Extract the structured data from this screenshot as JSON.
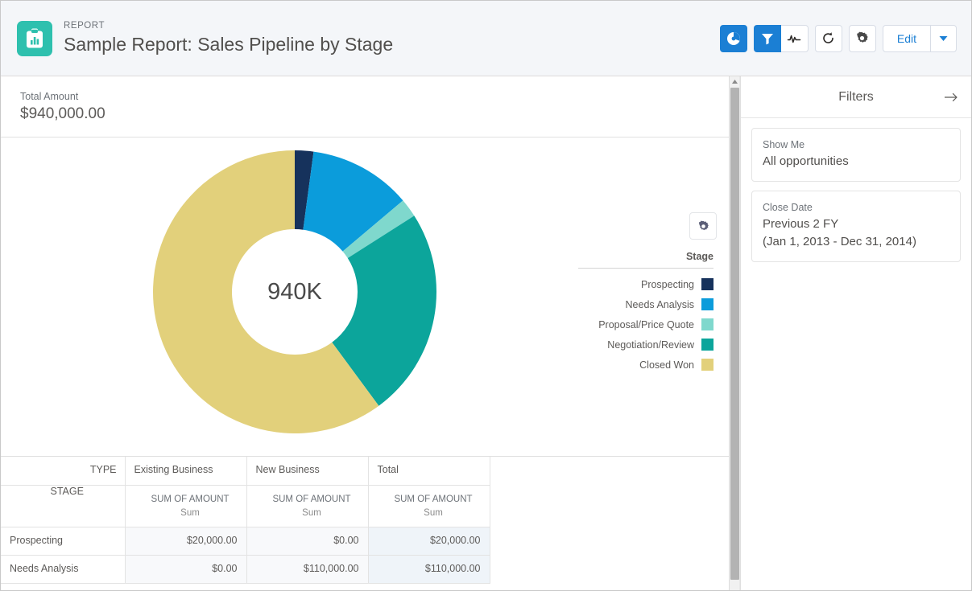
{
  "header": {
    "eyebrow": "REPORT",
    "title": "Sample Report: Sales Pipeline by Stage",
    "app_icon": "report-clipboard-icon",
    "toolbar": {
      "chart_toggle": "chart-icon",
      "filter_toggle": "filter-funnel-icon",
      "conditional_formatting": "pulse-icon",
      "refresh": "refresh-icon",
      "settings": "gear-icon",
      "edit_label": "Edit",
      "edit_menu": "chevron-down-icon"
    }
  },
  "summary": {
    "label": "Total Amount",
    "value": "$940,000.00"
  },
  "chart_data": {
    "type": "pie",
    "title": "",
    "center_label": "940K",
    "legend_title": "Stage",
    "legend_position": "right",
    "categories": [
      "Prospecting",
      "Needs Analysis",
      "Proposal/Price Quote",
      "Negotiation/Review",
      "Closed Won"
    ],
    "values": [
      20000,
      110000,
      20000,
      225000,
      565000
    ],
    "percentages": [
      2.1,
      11.7,
      2.1,
      23.9,
      60.2
    ],
    "colors": [
      "#16325c",
      "#0b9cdb",
      "#7fd8cd",
      "#0ca59b",
      "#e2d07b"
    ],
    "total": 940000,
    "value_format": "currency",
    "units": "USD"
  },
  "table": {
    "corner_type_label": "TYPE",
    "corner_stage_label": "STAGE",
    "columns": [
      "Existing Business",
      "New Business",
      "Total"
    ],
    "measure_name": "SUM OF AMOUNT",
    "measure_agg": "Sum",
    "rows": [
      {
        "stage": "Prospecting",
        "cells": [
          "$20,000.00",
          "$0.00",
          "$20,000.00"
        ]
      },
      {
        "stage": "Needs Analysis",
        "cells": [
          "$0.00",
          "$110,000.00",
          "$110,000.00"
        ]
      }
    ]
  },
  "filters": {
    "title": "Filters",
    "collapse_icon": "arrow-right-icon",
    "items": [
      {
        "name": "Show Me",
        "value": "All opportunities",
        "value2": ""
      },
      {
        "name": "Close Date",
        "value": "Previous 2 FY",
        "value2": "(Jan 1, 2013 - Dec 31, 2014)"
      }
    ]
  },
  "scrollbar": {
    "up_arrow": "scroll-up-arrow-icon"
  }
}
